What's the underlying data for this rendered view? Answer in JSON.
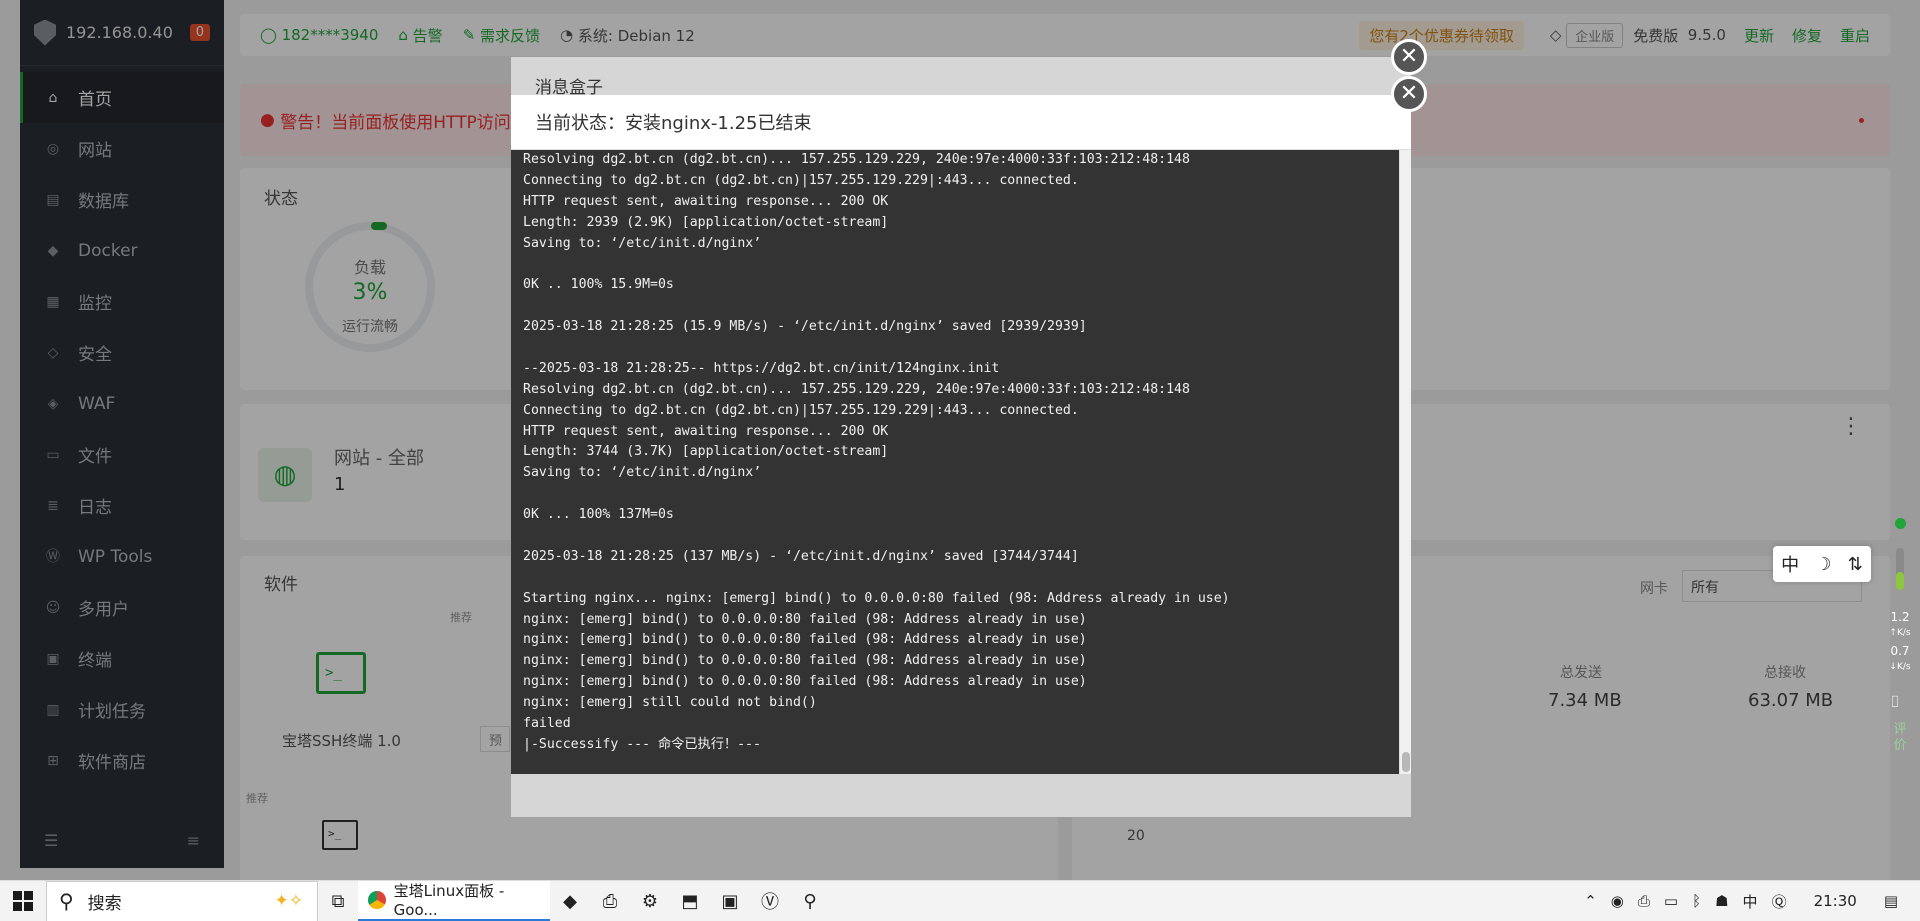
{
  "sidebar": {
    "ip": "192.168.0.40",
    "badge": "0",
    "items": [
      {
        "label": "首页",
        "icon": "home-icon"
      },
      {
        "label": "网站",
        "icon": "globe-icon"
      },
      {
        "label": "数据库",
        "icon": "database-icon"
      },
      {
        "label": "Docker",
        "icon": "docker-icon"
      },
      {
        "label": "监控",
        "icon": "monitor-icon"
      },
      {
        "label": "安全",
        "icon": "shield-icon"
      },
      {
        "label": "WAF",
        "icon": "waf-shield-icon"
      },
      {
        "label": "文件",
        "icon": "folder-icon"
      },
      {
        "label": "日志",
        "icon": "log-icon"
      },
      {
        "label": "WP Tools",
        "icon": "wordpress-icon"
      },
      {
        "label": "多用户",
        "icon": "users-icon"
      },
      {
        "label": "终端",
        "icon": "terminal-icon"
      },
      {
        "label": "计划任务",
        "icon": "calendar-icon"
      },
      {
        "label": "软件商店",
        "icon": "store-icon"
      }
    ]
  },
  "topbar": {
    "user": "182****3940",
    "alarm": "告警",
    "feedback": "需求反馈",
    "system": "系统: Debian 12",
    "coupon": "您有2个优惠券待领取",
    "enterprise": "企业版",
    "edition": "免费版",
    "version": "9.5.0",
    "update": "更新",
    "repair": "修复",
    "restart": "重启"
  },
  "warning": "警告！当前面板使用HTTP访问",
  "status": {
    "title": "状态",
    "gauge_label": "负载",
    "gauge_value": "3%",
    "gauge_sub": "运行流畅"
  },
  "site": {
    "label": "网站 - 全部",
    "count": "1"
  },
  "software": {
    "title": "软件",
    "tag": "推荐",
    "ssh_name": "宝塔SSH终端 1.0",
    "tag2": "推荐",
    "preview": "预"
  },
  "traffic": {
    "nic_label": "网卡",
    "nic_value": "所有",
    "sent_label": "总发送",
    "sent_value": "7.34 MB",
    "recv_label": "总接收",
    "recv_value": "63.07 MB",
    "axis_value": "20"
  },
  "dialog": {
    "back_title": "消息盒子",
    "status": "当前状态：安装nginx-1.25已结束",
    "lines": [
      "Resolving dg2.bt.cn (dg2.bt.cn)... 157.255.129.229, 240e:97e:4000:33f:103:212:48:148",
      "Connecting to dg2.bt.cn (dg2.bt.cn)|157.255.129.229|:443... connected.",
      "HTTP request sent, awaiting response... 200 OK",
      "Length: 2939 (2.9K) [application/octet-stream]",
      "Saving to: ‘/etc/init.d/nginx’",
      "",
      "0K .. 100% 15.9M=0s",
      "",
      "2025-03-18 21:28:25 (15.9 MB/s) - ‘/etc/init.d/nginx’ saved [2939/2939]",
      "",
      "--2025-03-18 21:28:25-- https://dg2.bt.cn/init/124nginx.init",
      "Resolving dg2.bt.cn (dg2.bt.cn)... 157.255.129.229, 240e:97e:4000:33f:103:212:48:148",
      "Connecting to dg2.bt.cn (dg2.bt.cn)|157.255.129.229|:443... connected.",
      "HTTP request sent, awaiting response... 200 OK",
      "Length: 3744 (3.7K) [application/octet-stream]",
      "Saving to: ‘/etc/init.d/nginx’",
      "",
      "0K ... 100% 137M=0s",
      "",
      "2025-03-18 21:28:25 (137 MB/s) - ‘/etc/init.d/nginx’ saved [3744/3744]",
      "",
      "Starting nginx... nginx: [emerg] bind() to 0.0.0.0:80 failed (98: Address already in use)",
      "nginx: [emerg] bind() to 0.0.0.0:80 failed (98: Address already in use)",
      "nginx: [emerg] bind() to 0.0.0.0:80 failed (98: Address already in use)",
      "nginx: [emerg] bind() to 0.0.0.0:80 failed (98: Address already in use)",
      "nginx: [emerg] bind() to 0.0.0.0:80 failed (98: Address already in use)",
      "nginx: [emerg] still could not bind()",
      "failed",
      "|-Successify --- 命令已执行！---"
    ]
  },
  "ime": {
    "a": "中",
    "b": "☽",
    "c": "⇅"
  },
  "speed": {
    "up": "1.2",
    "up_unit": "K/s",
    "down": "0.7",
    "down_unit": "K/s",
    "review": "评价"
  },
  "taskbar": {
    "search": "搜索",
    "app_title": "宝塔Linux面板 - Goo...",
    "time": "21:30",
    "ime_char": "中"
  }
}
